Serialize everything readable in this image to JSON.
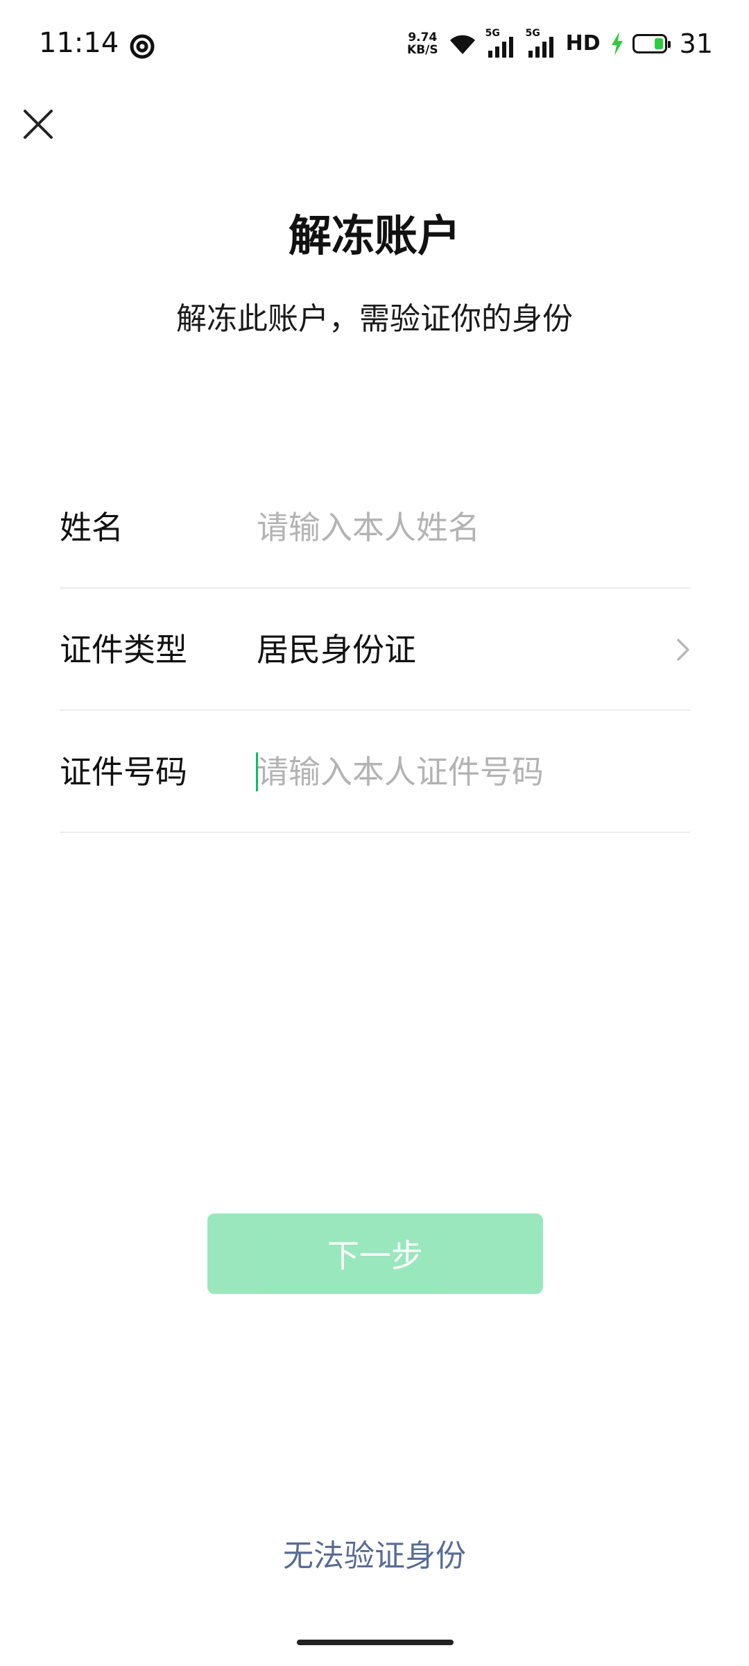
{
  "status_bar": {
    "time": "11:14",
    "net_speed_value": "9.74",
    "net_speed_unit": "KB/S",
    "signal_1_tag": "5G",
    "signal_2_tag": "5G",
    "hd_label": "HD",
    "battery_level": "31",
    "battery_fraction": 0.31,
    "battery_color": "#2ecc40",
    "icons": [
      "target-icon",
      "wifi-icon",
      "signal-icon",
      "signal-icon",
      "charging-icon",
      "battery-icon"
    ]
  },
  "header": {
    "close_icon": "close-icon",
    "title": "解冻账户",
    "subtitle": "解冻此账户，需验证你的身份"
  },
  "form": {
    "name": {
      "label": "姓名",
      "placeholder": "请输入本人姓名",
      "value": ""
    },
    "id_type": {
      "label": "证件类型",
      "value": "居民身份证",
      "icon": "chevron-right-icon"
    },
    "id_number": {
      "label": "证件号码",
      "placeholder": "请输入本人证件号码",
      "value": "",
      "focused": true
    }
  },
  "actions": {
    "next_label": "下一步",
    "next_enabled": false
  },
  "footer": {
    "cannot_verify_label": "无法验证身份"
  },
  "colors": {
    "accent": "#07c160",
    "button_disabled": "#88e3b1",
    "link": "#576b95",
    "placeholder": "#b3b3b3"
  }
}
